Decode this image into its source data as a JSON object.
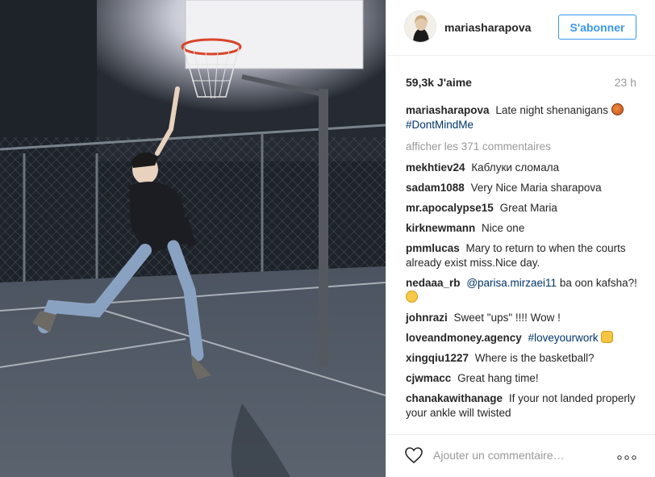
{
  "post": {
    "username": "mariasharapova",
    "follow_label": "S'abonner",
    "likes": "59,3k J'aime",
    "time_ago": "23 h",
    "caption_text": "Late night shenanigans",
    "caption_hashtag": "#DontMindMe",
    "view_all_label": "afficher les 371 commentaires",
    "add_comment_placeholder": "Ajouter un commentaire…"
  },
  "comments": [
    {
      "user": "mekhtiev24",
      "text": "Каблуки сломала"
    },
    {
      "user": "sadam1088",
      "text": "Very Nice Maria sharapova"
    },
    {
      "user": "mr.apocalypse15",
      "text": "Great Maria"
    },
    {
      "user": "kirknewmann",
      "text": "Nice one"
    },
    {
      "user": "pmmlucas",
      "text": "Mary to return to when the courts already exist miss.Nice day."
    },
    {
      "user": "nedaaa_rb",
      "mention": "@parisa.mirzaei11",
      "text": "ba oon kafsha?!"
    },
    {
      "user": "johnrazi",
      "text": "Sweet \"ups\" !!!! Wow !"
    },
    {
      "user": "loveandmoney.agency",
      "hashtag": "#loveyourwork"
    },
    {
      "user": "xingqiu1227",
      "text": "Where is the basketball?"
    },
    {
      "user": "cjwmacc",
      "text": "Great hang time!"
    },
    {
      "user": "chanakawithanage",
      "text": "If your not landed properly your ankle will twisted"
    }
  ],
  "icons": {
    "basketball": "basketball-emoji",
    "confused": "confused-face-emoji",
    "clap": "clapping-hands-emoji",
    "like": "heart-icon",
    "more": "more-options-icon"
  },
  "colors": {
    "link_blue": "#3897f0",
    "hashtag": "#003569",
    "muted": "#999999"
  }
}
